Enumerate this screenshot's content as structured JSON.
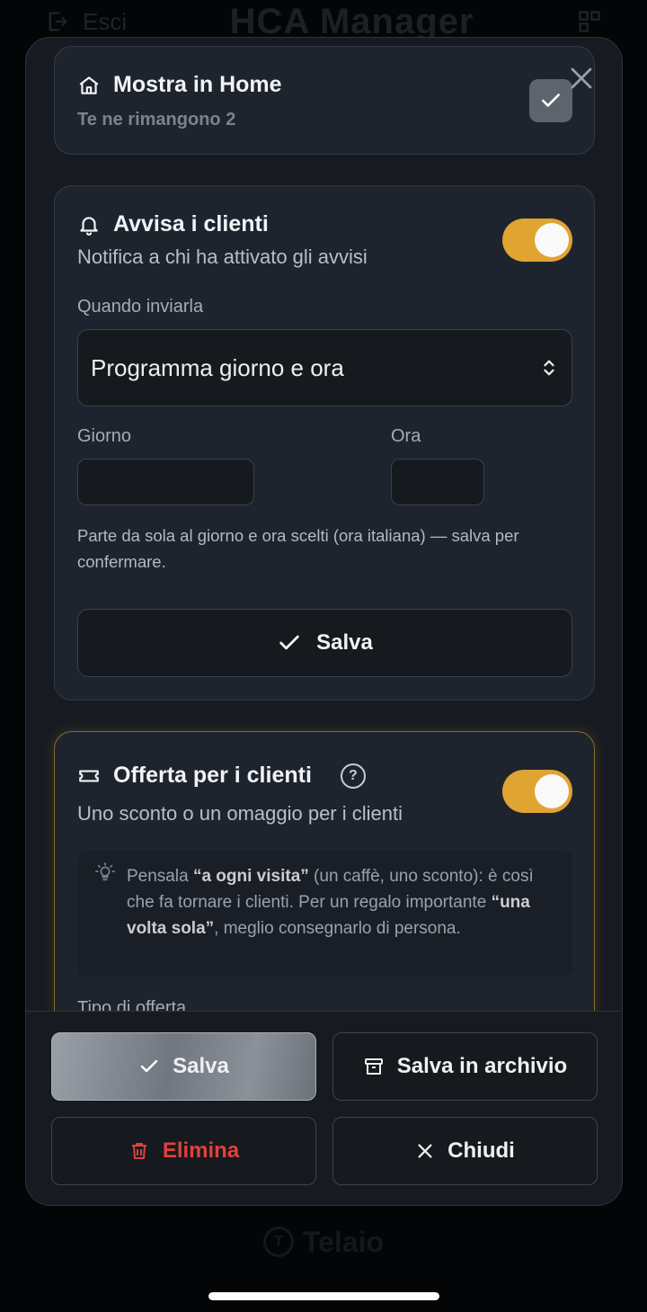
{
  "background": {
    "exit_label": "Esci",
    "app_title": "HCA Manager",
    "footer_brand": "Telaio"
  },
  "home_card": {
    "title": "Mostra in Home",
    "subtitle": "Te ne rimangono 2",
    "checked": true
  },
  "notify_card": {
    "title": "Avvisa i clienti",
    "subtitle": "Notifica a chi ha attivato gli avvisi",
    "toggle_on": true,
    "when_label": "Quando inviarla",
    "when_value": "Programma giorno e ora",
    "day_label": "Giorno",
    "day_value": "",
    "time_label": "Ora",
    "time_value": "",
    "hint": "Parte da sola al giorno e ora scelti (ora italiana) — salva per confermare.",
    "save_label": "Salva"
  },
  "offer_card": {
    "title": "Offerta per i clienti",
    "help_symbol": "?",
    "subtitle": "Uno sconto o un omaggio per i clienti",
    "toggle_on": true,
    "tip_part1": "Pensala ",
    "tip_bold1": "“a ogni visita”",
    "tip_part2": " (un caffè, uno sconto): è così che fa tornare i clienti. Per un regalo importante ",
    "tip_bold2": "“una volta sola”",
    "tip_part3": ", meglio consegnarlo di persona.",
    "type_label": "Tipo di offerta"
  },
  "footer": {
    "save_label": "Salva",
    "archive_label": "Salva in archivio",
    "delete_label": "Elimina",
    "close_label": "Chiudi"
  },
  "colors": {
    "accent": "#e0a432",
    "danger": "#e0413a",
    "modal_bg": "#171b21",
    "card_bg": "#1e242d"
  }
}
